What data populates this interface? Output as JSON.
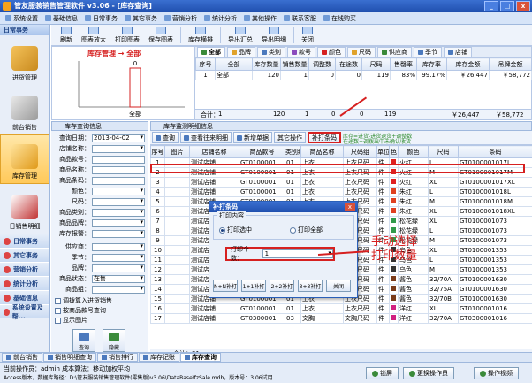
{
  "window": {
    "title": "管友服装销售管理软件 v3.06 - [库存查询]",
    "min": "_",
    "max": "□",
    "close": "x"
  },
  "menu": [
    "系统设置",
    "基础信息",
    "日常事务",
    "其它事务",
    "营销分析",
    "统计分析",
    "其他操作",
    "联系客服",
    "在线购买"
  ],
  "leftnav": {
    "header": "日常事务",
    "big": [
      "进货管理",
      "前台销售",
      "库存管理",
      "日销售明细"
    ],
    "small": [
      "日常事务",
      "其它事务",
      "营销分析",
      "统计分析",
      "基础信息",
      "系统设置及帮..."
    ]
  },
  "toolbar": [
    "刷新",
    "图表放大",
    "打印图表",
    "保存图表",
    "库存横排",
    "导出汇总",
    "导出明细",
    "关闭"
  ],
  "chart": {
    "title": "库存管理 → 全部",
    "bar_label": "0",
    "xlabel": "全部"
  },
  "chart_data": {
    "type": "bar",
    "title": "库存管理 → 全部",
    "categories": [
      "全部"
    ],
    "values": [
      0
    ],
    "data_labels": [
      "0"
    ]
  },
  "top_tabs": [
    "全部",
    "品牌",
    "类别",
    "款号",
    "颜色",
    "尺码",
    "供应商",
    "季节",
    "店铺"
  ],
  "top_grid": {
    "headers": [
      "序号",
      "全部",
      "库存数量",
      "销售数量",
      "调整数",
      "在途数",
      "尺码",
      "售罄率",
      "库存率",
      "库存金额",
      "吊牌金额"
    ],
    "rows": [
      [
        "1",
        "全部",
        "120",
        "1",
        "0",
        "0",
        "119",
        "83%",
        "99.17%",
        "￥26,447",
        "￥58,772"
      ]
    ],
    "totals_label": "合计：",
    "totals": [
      "1",
      "120",
      "1",
      "0",
      "0",
      "119",
      "￥26,447",
      "￥58,772"
    ]
  },
  "left_tab": "库存查询信息",
  "right_tab": "库存监测明细信息",
  "query": {
    "fields": [
      {
        "label": "查询日期：",
        "value": "2013-04-02"
      },
      {
        "label": "店铺名称：",
        "value": ""
      },
      {
        "label": "商品款号：",
        "value": ""
      },
      {
        "label": "商品名称：",
        "value": ""
      },
      {
        "label": "商品条码：",
        "value": ""
      },
      {
        "label": "颜色：",
        "value": ""
      },
      {
        "label": "尺码：",
        "value": ""
      },
      {
        "label": "商品类别：",
        "value": ""
      },
      {
        "label": "商品品牌：",
        "value": ""
      },
      {
        "label": "库存报警：",
        "value": ""
      },
      {
        "label": "供应商：",
        "value": ""
      },
      {
        "label": "季节：",
        "value": ""
      },
      {
        "label": "品牌：",
        "value": ""
      },
      {
        "label": "商品状态：",
        "value": "在售"
      },
      {
        "label": "商品组：",
        "value": ""
      }
    ],
    "checks": [
      "调拨算入进货销售",
      "按商品款号查询",
      "显示图片"
    ],
    "btn_query": "查询",
    "btn_print": "隐藏"
  },
  "detail_toolbar": {
    "buttons": [
      "查询",
      "查看往来明细",
      "新增单据",
      "其它操作",
      "补打条码"
    ],
    "hint1": "库存=进货-进货退货+调整数",
    "hint2": "在途数=调拨出中未确认收货"
  },
  "detail_grid": {
    "headers": [
      "序号",
      "图片",
      "店铺名称",
      "商品款号",
      "类别编号",
      "商品名称",
      "尺码组",
      "单位",
      "色",
      "颜色",
      "尺码",
      "条码"
    ],
    "rows": [
      [
        "1",
        "",
        "测试店铺",
        "GT0100001",
        "01",
        "上衣",
        "上衣尺码",
        "件",
        "",
        "火红",
        "L",
        "GT0100001017L"
      ],
      [
        "2",
        "",
        "测试店铺",
        "GT0100001",
        "01",
        "上衣",
        "上衣尺码",
        "件",
        "",
        "火红",
        "M",
        "GT0100001017M"
      ],
      [
        "3",
        "",
        "测试店铺",
        "GT0100001",
        "01",
        "上衣",
        "上衣尺码",
        "件",
        "",
        "火红",
        "XL",
        "GT0100001017XL"
      ],
      [
        "4",
        "",
        "测试店铺",
        "GT0100001",
        "01",
        "上衣",
        "上衣尺码",
        "件",
        "",
        "朱红",
        "L",
        "GT0100001018L"
      ],
      [
        "5",
        "",
        "测试店铺",
        "GT0100001",
        "01",
        "上衣",
        "上衣尺码",
        "件",
        "",
        "朱红",
        "M",
        "GT0100001018M"
      ],
      [
        "6",
        "",
        "测试店铺",
        "GT0100001",
        "01",
        "上衣",
        "上衣尺码",
        "件",
        "",
        "朱红",
        "XL",
        "GT0100001018XL"
      ],
      [
        "7",
        "",
        "测试店铺",
        "GT0100001",
        "01",
        "上衣",
        "上衣尺码",
        "件",
        "",
        "松花绿",
        "XL",
        "GT0100001073"
      ],
      [
        "8",
        "",
        "测试店铺",
        "GT0100001",
        "01",
        "上衣",
        "上衣尺码",
        "件",
        "",
        "松花绿",
        "L",
        "GT0100001073"
      ],
      [
        "9",
        "",
        "测试店铺",
        "GT0100001",
        "01",
        "上衣",
        "上衣尺码",
        "件",
        "",
        "松花绿",
        "M",
        "GT0100001073"
      ],
      [
        "10",
        "",
        "测试店铺",
        "GT0100001",
        "01",
        "上衣",
        "上衣尺码",
        "件",
        "",
        "乌色",
        "XL",
        "GT0100001353"
      ],
      [
        "11",
        "",
        "测试店铺",
        "GT0100001",
        "01",
        "上衣",
        "上衣尺码",
        "件",
        "",
        "乌色",
        "L",
        "GT0100001353"
      ],
      [
        "12",
        "",
        "测试店铺",
        "GT0100001",
        "01",
        "上衣",
        "上衣尺码",
        "件",
        "",
        "乌色",
        "M",
        "GT0100001353"
      ],
      [
        "13",
        "",
        "测试店铺",
        "GT0100001",
        "01",
        "上衣",
        "上衣尺码",
        "件",
        "",
        "酱色",
        "32/70A",
        "GT0100001630"
      ],
      [
        "14",
        "",
        "测试店铺",
        "GT0100001",
        "01",
        "上衣",
        "上衣尺码",
        "件",
        "",
        "酱色",
        "32/75A",
        "GT0100001630"
      ],
      [
        "15",
        "",
        "测试店铺",
        "GT0100001",
        "01",
        "上衣",
        "上衣尺码",
        "件",
        "",
        "酱色",
        "32/70B",
        "GT0100001630"
      ],
      [
        "16",
        "",
        "测试店铺",
        "GT0100001",
        "01",
        "上衣",
        "上衣尺码",
        "件",
        "",
        "洋红",
        "XL",
        "GT0100001016"
      ],
      [
        "17",
        "",
        "测试店铺",
        "GT0300001",
        "03",
        "文胸",
        "文胸尺码",
        "件",
        "",
        "洋红",
        "32/70A",
        "GT0300001016"
      ]
    ],
    "totals": "合计：31"
  },
  "dialog": {
    "title": "补打条码",
    "close": "x",
    "group": "打印内容",
    "radio1": "打印选中",
    "radio2": "打印全部",
    "count_label": "打印个数：",
    "count_value": "1",
    "buttons": [
      "N+N补打",
      "1+1补打",
      "2+2补打",
      "3+3补打",
      "关闭"
    ]
  },
  "annotation": {
    "line1": "手动选择",
    "line2": "打印数量"
  },
  "bottom_tabs": [
    "前台销售",
    "销售明细查询",
    "销售排行",
    "库存记账",
    "库存查询"
  ],
  "status": {
    "line1": "当前操作员：admin 成本算法：移动加权平均",
    "line2": "Access版本，数据库路径：D:\\管友服装销售管理软件(零售版)v3.06\\DataBase\\fzSale.mdb，版本号：3.06试用",
    "btn_lock": "锁屏",
    "btn_switch": "更换操作员",
    "btn_video": "操作视频"
  },
  "colors": {
    "accent": "#d62020",
    "hint_green": "#2b8a2b",
    "title_blue": "#1f4fae"
  }
}
